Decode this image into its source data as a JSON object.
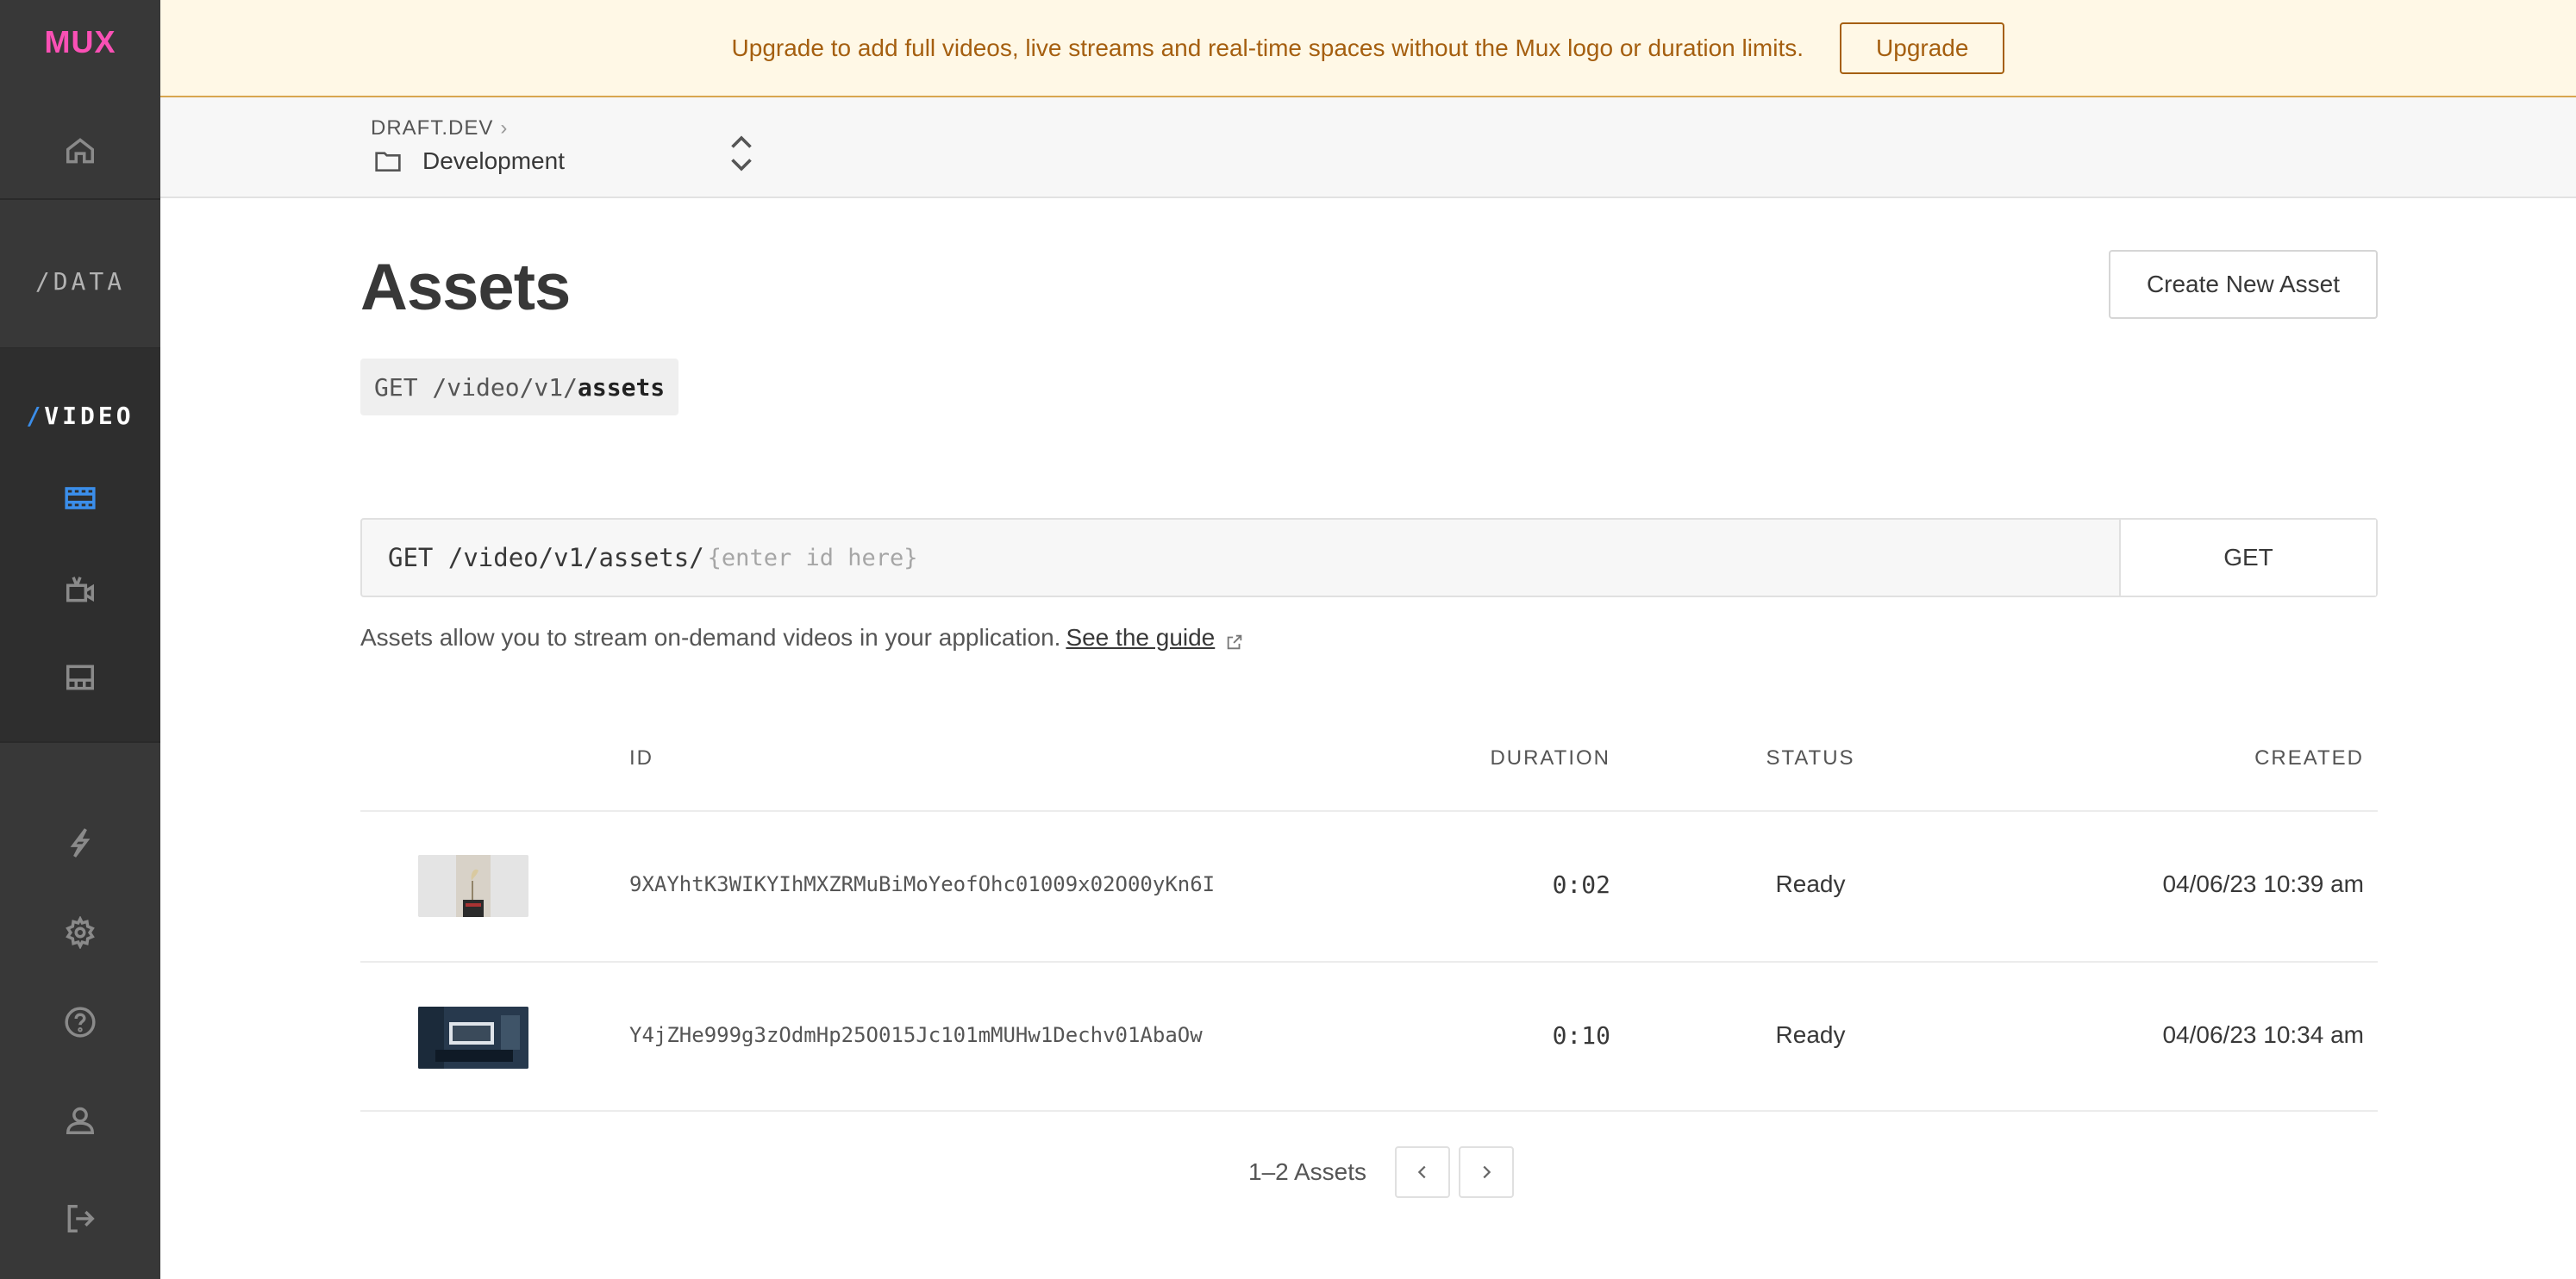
{
  "brand": {
    "logo": "MUX"
  },
  "sidebar": {
    "data_label": "/DATA",
    "video_label_slash": "/",
    "video_label": "VIDEO"
  },
  "banner": {
    "text": "Upgrade to add full videos, live streams and real-time spaces without the Mux logo or duration limits.",
    "button": "Upgrade"
  },
  "env": {
    "org": "DRAFT.DEV",
    "environment": "Development"
  },
  "main": {
    "title": "Assets",
    "create_button": "Create New Asset",
    "api_chip_prefix": "GET /video/v1/",
    "api_chip_resource": "assets",
    "get_prefix": "GET",
    "get_path": "/video/v1/assets/",
    "get_placeholder": "{enter id here}",
    "get_button": "GET",
    "description": "Assets allow you to stream on-demand videos in your application.",
    "guide_link": "See the guide"
  },
  "table": {
    "columns": {
      "id": "ID",
      "duration": "DURATION",
      "status": "STATUS",
      "created": "CREATED"
    },
    "rows": [
      {
        "id": "9XAYhtK3WIKYIhMXZRMuBiMoYeofOhc01009x02O00yKn6I",
        "duration": "0:02",
        "status": "Ready",
        "created": "04/06/23 10:39 am"
      },
      {
        "id": "Y4jZHe999g3zOdmHp25O015Jc101mMUHw1Dechv01AbaOw",
        "duration": "0:10",
        "status": "Ready",
        "created": "04/06/23 10:34 am"
      }
    ]
  },
  "pagination": {
    "label": "1–2 Assets"
  },
  "colors": {
    "accent_blue": "#3b8eea",
    "banner_bg": "#fff8e6",
    "banner_text": "#a55f10",
    "sidebar_bg": "#383838"
  }
}
